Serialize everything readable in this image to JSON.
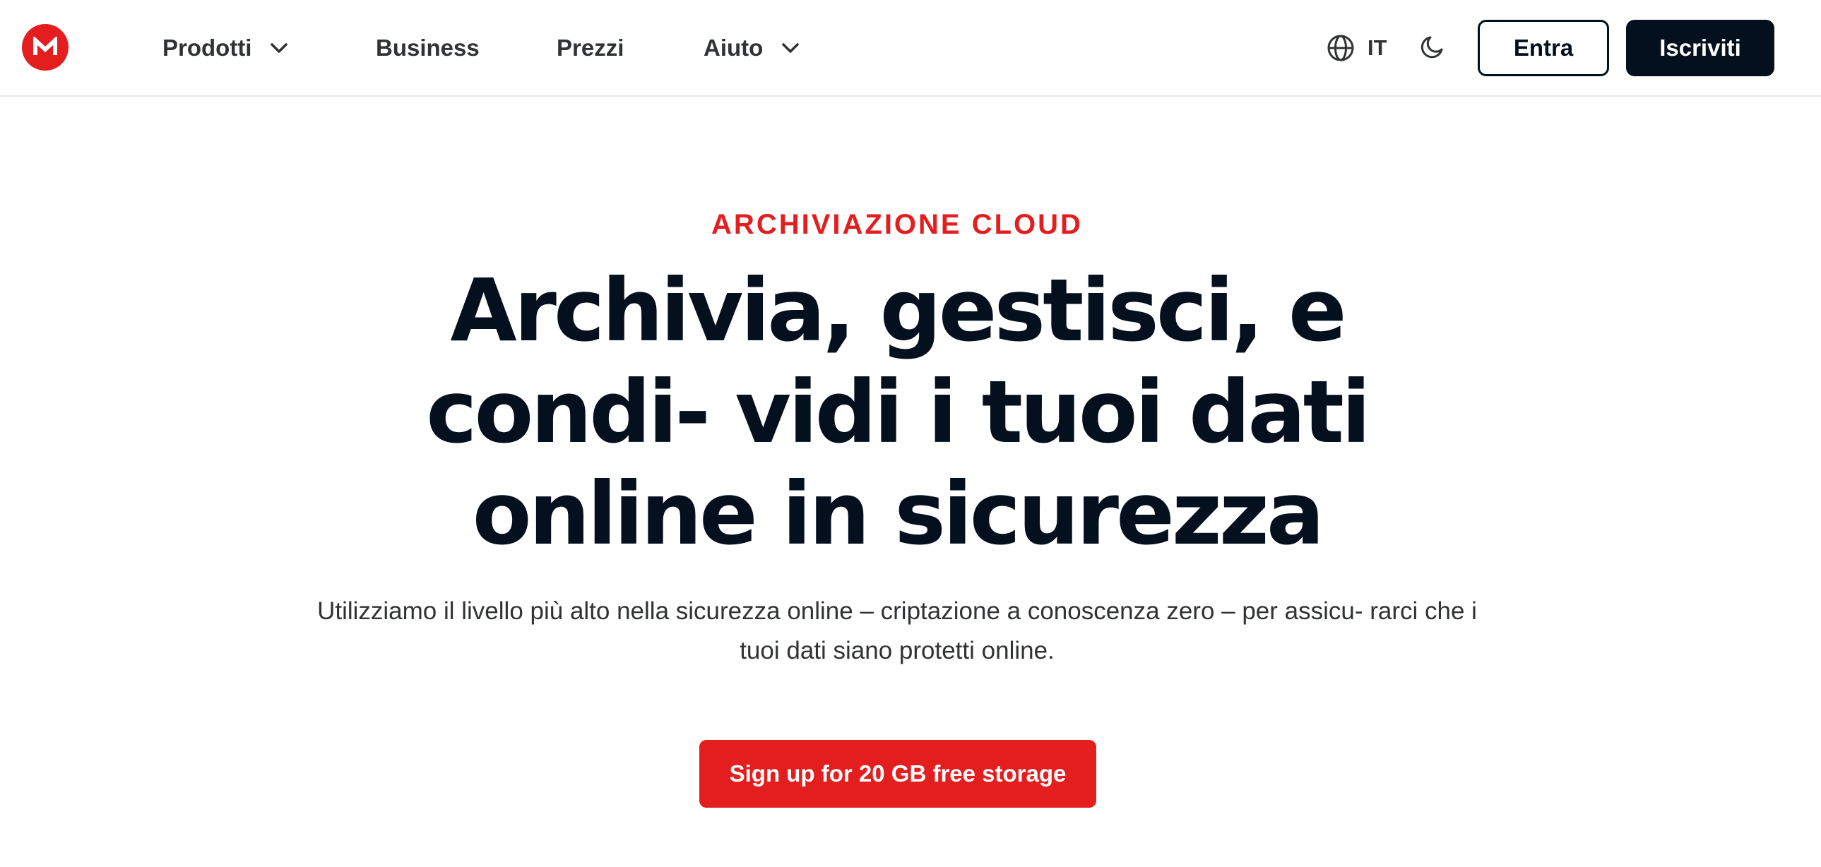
{
  "header": {
    "logo_icon": "mega-logo-icon",
    "nav": {
      "products": "Prodotti",
      "business": "Business",
      "pricing": "Prezzi",
      "help": "Aiuto"
    },
    "language_code": "IT",
    "login_label": "Entra",
    "signup_label": "Iscriviti"
  },
  "hero": {
    "eyebrow": "ARCHIVIAZIONE CLOUD",
    "title": "Archivia, gestisci, e condi- vidi i tuoi dati online in sicurezza",
    "subtitle": "Utilizziamo il livello più alto nella sicurezza online – criptazione a conoscenza zero – per assicu- rarci che i tuoi dati siano protetti online.",
    "cta_label": "Sign up for 20 GB free storage"
  },
  "colors": {
    "brand_red": "#e41e1e",
    "dark_navy": "#04101e",
    "text_gray": "#303233",
    "divider": "#e6e8ea"
  }
}
